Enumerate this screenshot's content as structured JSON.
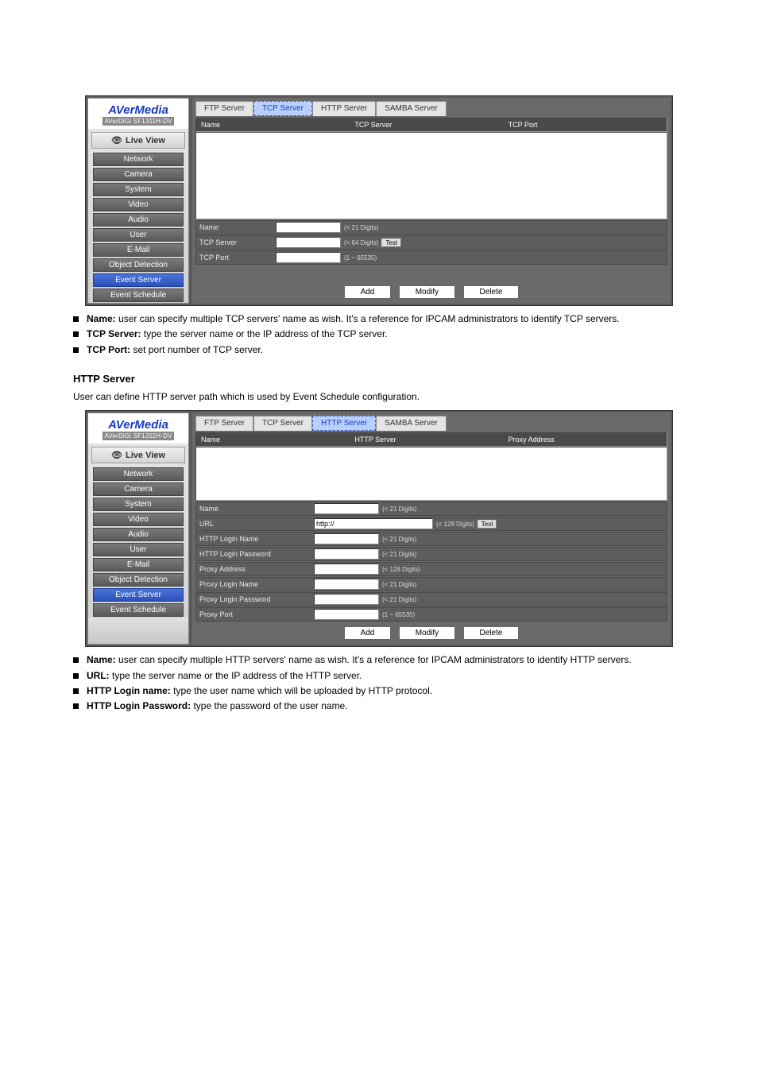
{
  "logo_main": "AVerMedia",
  "logo_sub": "AVerDiGi SF1311H-DV",
  "sidebar": {
    "live_view": "Live View",
    "items": [
      {
        "label": "Network"
      },
      {
        "label": "Camera"
      },
      {
        "label": "System"
      },
      {
        "label": "Video"
      },
      {
        "label": "Audio"
      },
      {
        "label": "User"
      },
      {
        "label": "E-Mail"
      },
      {
        "label": "Object Detection"
      },
      {
        "label": "Event Server"
      },
      {
        "label": "Event Schedule"
      }
    ]
  },
  "tabs": {
    "ftp": "FTP Server",
    "tcp": "TCP Server",
    "http": "HTTP Server",
    "samba": "SAMBA Server"
  },
  "tcp_panel": {
    "headers": {
      "c1": "Name",
      "c2": "TCP Server",
      "c3": "TCP Port"
    },
    "rows": {
      "name": {
        "label": "Name",
        "hint": "(< 21 Digits)"
      },
      "server": {
        "label": "TCP Server",
        "hint": "(< 64 Digits)",
        "test": "Test"
      },
      "port": {
        "label": "TCP Port",
        "hint": "(1 ~ 65535)"
      }
    }
  },
  "http_panel": {
    "headers": {
      "c1": "Name",
      "c2": "HTTP Server",
      "c3": "Proxy Address"
    },
    "rows": {
      "name": {
        "label": "Name",
        "hint": "(< 21 Digits)"
      },
      "url": {
        "label": "URL",
        "value": "http://",
        "hint": "(< 128 Digits)",
        "test": "Test"
      },
      "login": {
        "label": "HTTP Login Name",
        "hint": "(< 21 Digits)"
      },
      "pass": {
        "label": "HTTP Login Password",
        "hint": "(< 21 Digits)"
      },
      "proxy_addr": {
        "label": "Proxy Address",
        "hint": "(< 128 Digits)"
      },
      "proxy_login": {
        "label": "Proxy Login Name",
        "hint": "(< 21 Digits)"
      },
      "proxy_pass": {
        "label": "Proxy Login Password",
        "hint": "(< 21 Digits)"
      },
      "proxy_port": {
        "label": "Proxy Port",
        "hint": "(1 ~ 65535)"
      }
    }
  },
  "buttons": {
    "add": "Add",
    "modify": "Modify",
    "delete": "Delete"
  },
  "doc": {
    "tcp_b1_label": "Name:",
    "tcp_b1_text": " user can specify multiple TCP servers' name as wish. It's a reference for IPCAM administrators to identify TCP servers.",
    "tcp_b2_label": "TCP Server:",
    "tcp_b2_text": " type the server name or the IP address of the TCP server.",
    "tcp_b3_label": "TCP Port:",
    "tcp_b3_text": " set port number of TCP server.",
    "http_title": "HTTP Server",
    "http_intro": "User can define HTTP server path which is used by Event Schedule configuration.",
    "http_b1_label": "Name:",
    "http_b1_text": " user can specify multiple HTTP servers' name as wish. It's a reference for IPCAM administrators to identify HTTP servers.",
    "http_b2_label": "URL:",
    "http_b2_text": " type the server name or the IP address of the HTTP server.",
    "http_b3_label": "HTTP Login name:",
    "http_b3_text": " type the user name which will be uploaded by HTTP protocol.",
    "http_b4_label": "HTTP Login Password:",
    "http_b4_text": " type the password of the user name."
  }
}
